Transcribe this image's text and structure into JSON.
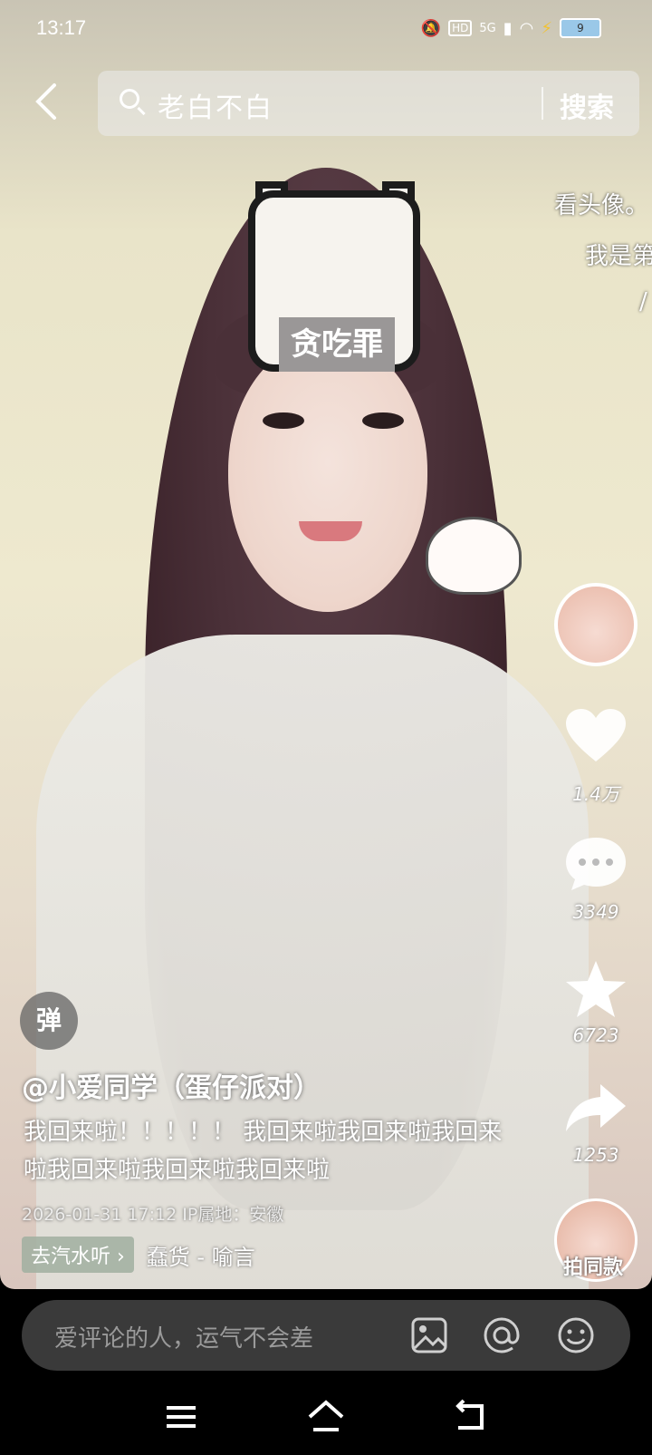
{
  "status_bar": {
    "time": "13:17",
    "network": "5G",
    "hd": "HD",
    "battery": "9"
  },
  "search": {
    "query": "老白不白",
    "button_label": "搜索"
  },
  "video": {
    "sticker_text": "贪吃罪",
    "deco_lines": [
      "看头像。",
      "我是第",
      "/"
    ]
  },
  "actions": {
    "like_count": "1.4万",
    "comment_count": "3349",
    "favorite_count": "6723",
    "share_count": "1253",
    "same_style_label": "拍同款"
  },
  "info": {
    "danmu_label": "弹",
    "author": "@小爱同学（蛋仔派对）",
    "description": "我回来啦！！！！！ 我回来啦我回来啦我回来啦我回来啦我回来啦我回来啦",
    "meta": "2026-01-31 17:12  IP属地：安徽",
    "music_tag": "去汽水听 ›",
    "music_name": "蠢货 - 喻言"
  },
  "comment_bar": {
    "placeholder": "爱评论的人，运气不会差"
  },
  "colors": {
    "comment_bar_bg": "#3a3a3a",
    "music_tag_bg": "#a0afa0"
  }
}
